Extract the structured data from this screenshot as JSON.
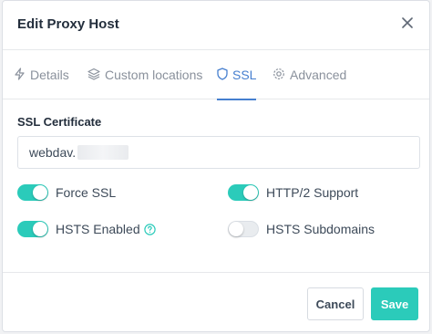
{
  "modal": {
    "title": "Edit Proxy Host"
  },
  "tabs": [
    {
      "label": "Details",
      "icon": "lightning-icon",
      "active": false
    },
    {
      "label": "Custom locations",
      "icon": "layers-icon",
      "active": false
    },
    {
      "label": "SSL",
      "icon": "shield-icon",
      "active": true
    },
    {
      "label": "Advanced",
      "icon": "gear-icon",
      "active": false
    }
  ],
  "ssl": {
    "certificate_label": "SSL Certificate",
    "certificate_value": "webdav."
  },
  "toggles": {
    "force_ssl": {
      "label": "Force SSL",
      "on": true
    },
    "http2": {
      "label": "HTTP/2 Support",
      "on": true
    },
    "hsts_enabled": {
      "label": "HSTS Enabled",
      "on": true
    },
    "hsts_subdomains": {
      "label": "HSTS Subdomains",
      "on": false
    }
  },
  "footer": {
    "cancel_label": "Cancel",
    "save_label": "Save"
  },
  "colors": {
    "accent": "#2bcbba",
    "tab_active": "#467fcf"
  }
}
